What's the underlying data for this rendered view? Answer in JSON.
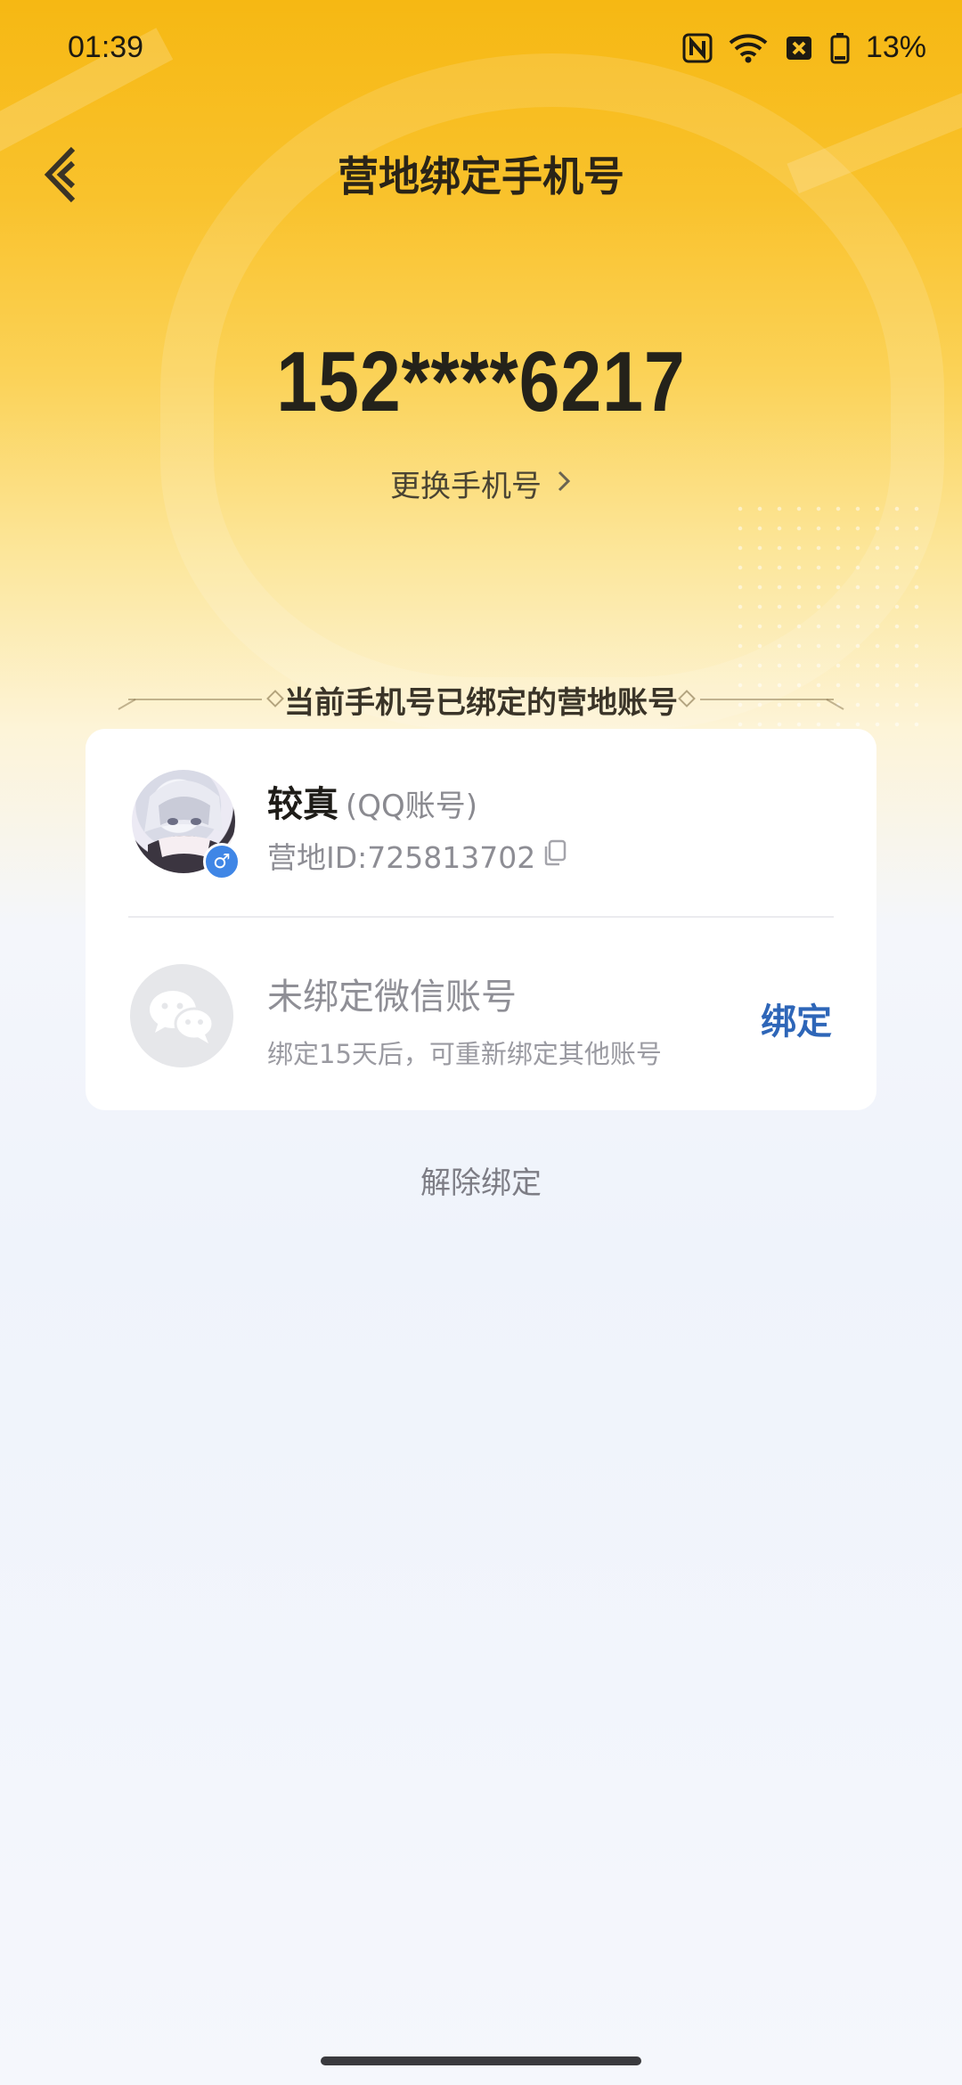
{
  "status_bar": {
    "time": "01:39",
    "battery_percent": "13%",
    "icons": [
      "nfc-icon",
      "wifi-icon",
      "no-sim-icon",
      "battery-icon"
    ]
  },
  "header": {
    "title": "营地绑定手机号",
    "back_icon": "back-arrow-icon"
  },
  "phone": {
    "number": "152****6217",
    "change_label": "更换手机号"
  },
  "section": {
    "title": "当前手机号已绑定的营地账号"
  },
  "accounts": {
    "qq": {
      "name": "较真",
      "type": "(QQ账号)",
      "camp_id": "营地ID:725813702",
      "gender": "male"
    },
    "wechat": {
      "title": "未绑定微信账号",
      "hint": "绑定15天后，可重新绑定其他账号",
      "bind_label": "绑定"
    }
  },
  "unbind_label": "解除绑定",
  "colors": {
    "accent_yellow": "#f9c22c",
    "bind_blue": "#2e66b8",
    "gender_blue": "#3f86e6"
  }
}
